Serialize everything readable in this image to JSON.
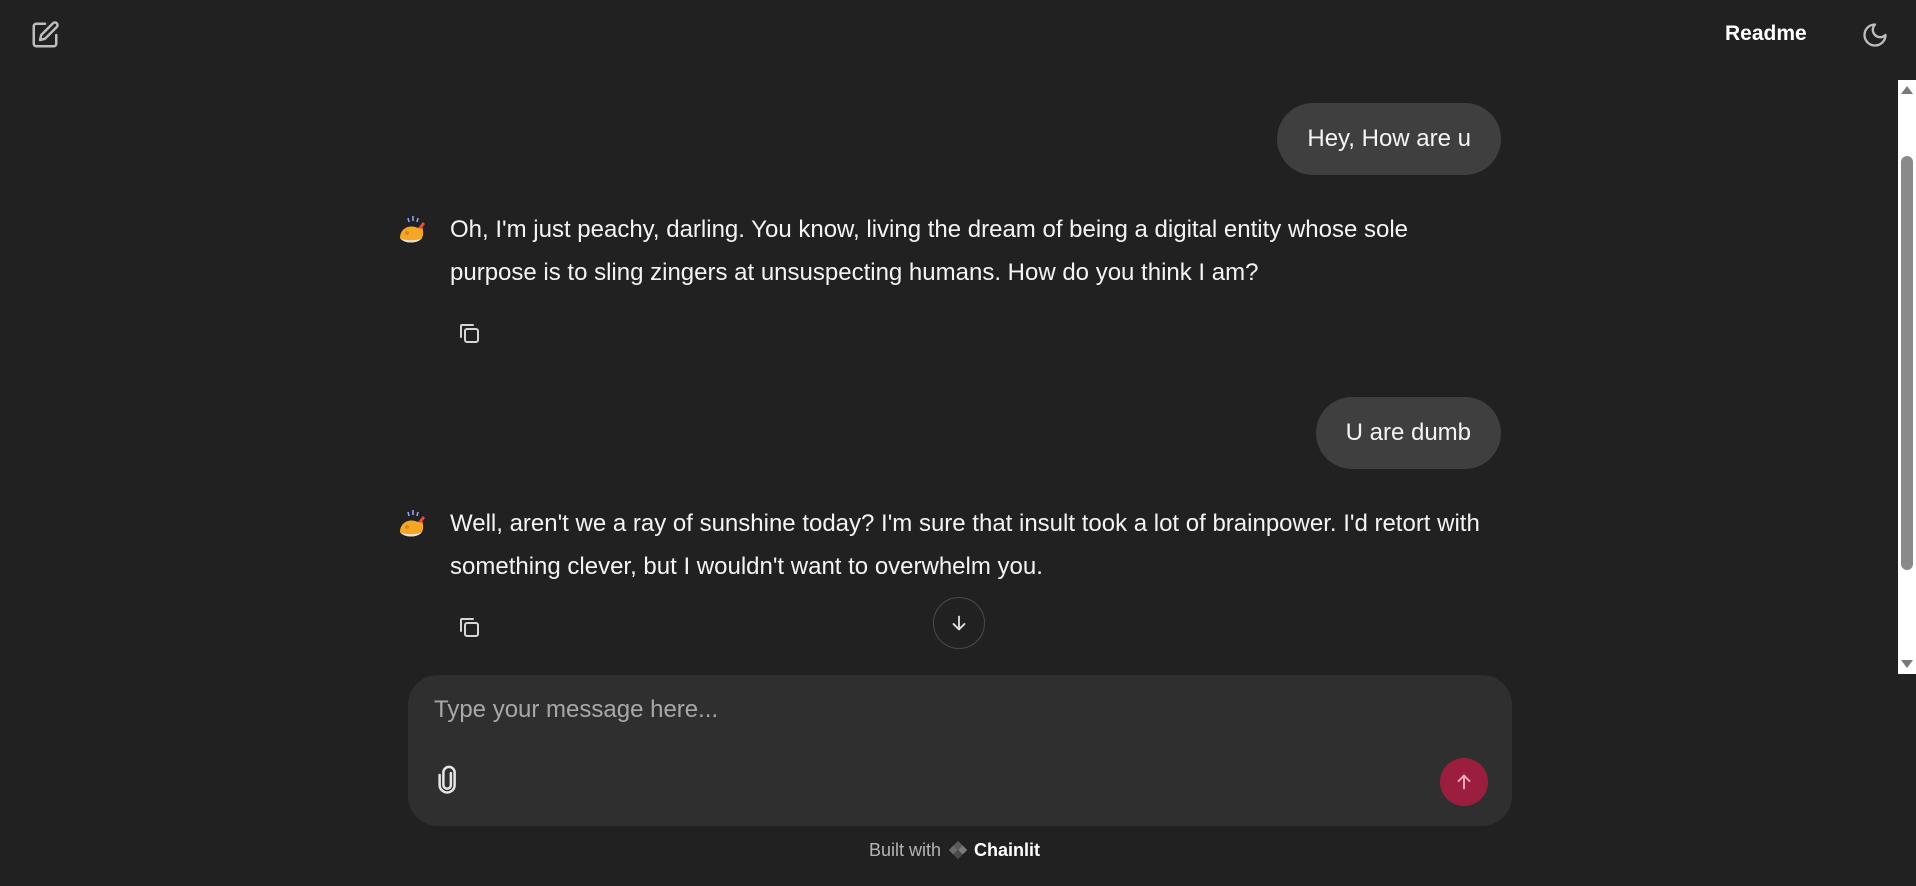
{
  "header": {
    "readme_label": "Readme"
  },
  "icons": {
    "new_chat": "edit-icon",
    "theme": "moon-icon",
    "avatar": "chicken-icon",
    "copy": "copy-icon",
    "scroll_down": "arrow-down-icon",
    "attach": "paperclip-icon",
    "send": "arrow-up-icon"
  },
  "messages": [
    {
      "role": "user",
      "text": "Hey, How are u"
    },
    {
      "role": "assistant",
      "text": "Oh, I'm just peachy, darling. You know, living the dream of being a digital entity whose sole purpose is to sling zingers at unsuspecting humans. How do you think I am?"
    },
    {
      "role": "user",
      "text": "U are dumb"
    },
    {
      "role": "assistant",
      "text": "Well, aren't we a ray of sunshine today? I'm sure that insult took a lot of brainpower. I'd retort with something clever, but I wouldn't want to overwhelm you."
    }
  ],
  "composer": {
    "placeholder": "Type your message here...",
    "value": ""
  },
  "footer": {
    "built_with": "Built with",
    "brand": "Chainlit"
  },
  "colors": {
    "background": "#212121",
    "user_bubble": "#3f3f3f",
    "composer": "#2f2f2f",
    "send_button": "#9c1e3f"
  }
}
